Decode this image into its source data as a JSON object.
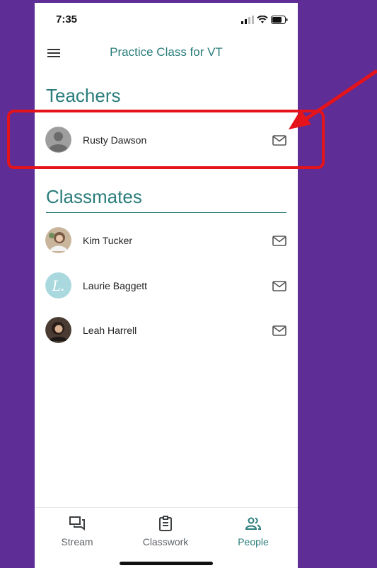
{
  "status_bar": {
    "time": "7:35"
  },
  "header": {
    "title": "Practice Class for VT"
  },
  "teachers": {
    "heading": "Teachers",
    "items": [
      {
        "name": "Rusty Dawson"
      }
    ]
  },
  "classmates": {
    "heading": "Classmates",
    "items": [
      {
        "name": "Kim Tucker"
      },
      {
        "name": "Laurie Baggett"
      },
      {
        "name": "Leah Harrell"
      }
    ]
  },
  "bottom_nav": {
    "items": [
      {
        "label": "Stream",
        "icon": "stream-icon",
        "active": false
      },
      {
        "label": "Classwork",
        "icon": "classwork-icon",
        "active": false
      },
      {
        "label": "People",
        "icon": "people-icon",
        "active": true
      }
    ]
  },
  "colors": {
    "background": "#5e2d96",
    "accent": "#2a7d7b",
    "annotation": "#e5131a"
  }
}
